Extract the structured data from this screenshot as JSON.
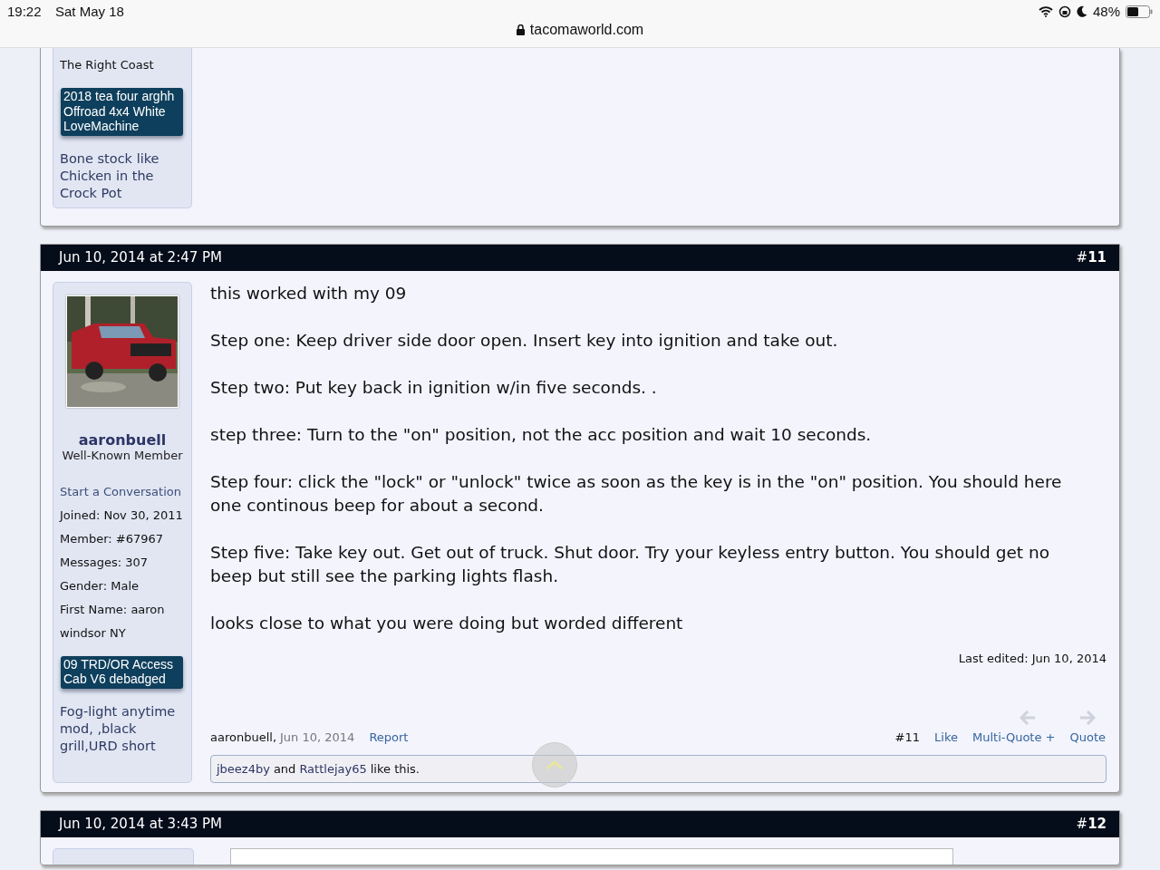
{
  "status_bar": {
    "time": "19:22",
    "date": "Sat May 18",
    "url": "tacomaworld.com",
    "battery": "48%"
  },
  "posts": [
    {
      "kind": "tail",
      "location": "The Right Coast",
      "vehicle": "2018 tea four arghh Offroad 4x4 White LoveMachine",
      "signature": "Bone stock like Chicken in the Crock Pot"
    },
    {
      "kind": "full",
      "date": "Jun 10, 2014 at 2:47 PM",
      "number": "#**11**",
      "username": "aaronbuell",
      "user_title": "Well-Known Member",
      "start_conversation": "Start a Conversation",
      "stats": [
        {
          "label": "Joined:",
          "value": "Nov 30, 2011"
        },
        {
          "label": "Member:",
          "value": "#67967"
        },
        {
          "label": "Messages:",
          "value": "307"
        },
        {
          "label": "Gender:",
          "value": "Male"
        },
        {
          "label": "First Name:",
          "value": "aaron"
        }
      ],
      "location": "windsor NY",
      "vehicle": "09 TRD/OR Access Cab V6 debadged",
      "signature": "Fog-light anytime mod, ,black grill,URD short",
      "message": [
        "this worked with my 09",
        "Step one: Keep driver side door open. Insert key into ignition and take out.",
        "Step two: Put key back in ignition w/in five seconds. .",
        "step three: Turn to the \"on\" position, not the acc position and wait 10 seconds.",
        "Step four: click the \"lock\" or \"unlock\" twice as soon as the key is in the \"on\" position. You should here one continous beep for about a second.",
        "Step five: Take key out. Get out of truck. Shut door. Try your keyless entry button. You should get no beep but still see the parking lights flash.",
        "looks close to what you were doing but worded different"
      ],
      "last_edited": "Last edited: Jun 10, 2014",
      "footer": {
        "author": "aaronbuell,",
        "date": "Jun 10, 2014",
        "report": "Report",
        "post_number": "#11",
        "like": "Like",
        "multi_quote": "Multi-Quote +",
        "quote": "Quote"
      },
      "likes": {
        "users": [
          "jbeez4by",
          "Rattlejay65"
        ],
        "joiner": "and",
        "suffix": "like this."
      }
    },
    {
      "kind": "head",
      "date": "Jun 10, 2014 at 3:43 PM",
      "number": "#**12**"
    }
  ]
}
